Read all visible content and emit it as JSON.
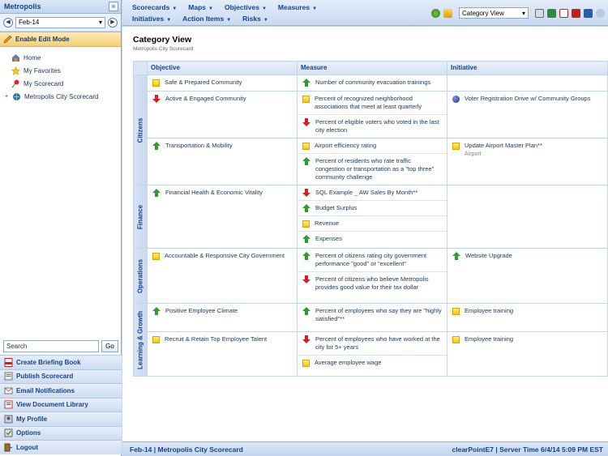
{
  "sidebar": {
    "title": "Metropolis",
    "period": "Feb-14",
    "edit_mode": "Enable Edit Mode",
    "tree": [
      {
        "label": "Home",
        "icon": "home-icon"
      },
      {
        "label": "My Favorites",
        "icon": "star-icon"
      },
      {
        "label": "My Scorecard",
        "icon": "pin-icon"
      },
      {
        "label": "Metropolis City Scorecard",
        "icon": "scorecard-icon"
      }
    ],
    "search_value": "Search",
    "go_label": "Go",
    "actions": [
      {
        "label": "Create Briefing Book",
        "icon": "pdf-icon"
      },
      {
        "label": "Publish Scorecard",
        "icon": "publish-icon"
      },
      {
        "label": "Email Notifications",
        "icon": "email-icon"
      },
      {
        "label": "View Document Library",
        "icon": "library-icon"
      },
      {
        "label": "My Profile",
        "icon": "profile-icon"
      },
      {
        "label": "Options",
        "icon": "options-icon"
      },
      {
        "label": "Logout",
        "icon": "logout-icon"
      }
    ]
  },
  "topbar": {
    "menu_row1": [
      "Scorecards",
      "Maps",
      "Objectives",
      "Measures"
    ],
    "menu_row2": [
      "Initiatives",
      "Action Items",
      "Risks"
    ],
    "view_select": "Category View"
  },
  "main": {
    "title": "Category View",
    "subtitle": "Metropolis City Scorecard",
    "headers": {
      "objective": "Objective",
      "measure": "Measure",
      "initiative": "Initiative"
    },
    "categories": [
      {
        "name": "Citizens"
      },
      {
        "name": "Finance"
      },
      {
        "name": "Operations"
      },
      {
        "name": "Learning & Growth"
      }
    ],
    "rows": {
      "r1": {
        "objective": "Safe & Prepared Community",
        "measures": [
          "Number of community evacuation trainings"
        ]
      },
      "r2": {
        "objective": "Active & Engaged Community",
        "measures": [
          "Percent of recognized neighborhood associations that meet at least quarterly",
          "Percent of eligible voters who voted in the last city election"
        ],
        "initiative": "Voter Registration Drive w/ Community Groups"
      },
      "r3": {
        "objective": "Transportation & Mobility",
        "measures": [
          "Airport efficiency rating",
          "Percent of residents who rate traffic congestion or transportation as a \"top three\" community challenge"
        ],
        "initiative": "Update Airport Master Plan**",
        "initiative_sub": "Airport"
      },
      "r4": {
        "objective": "Financial Health & Economic Vitality",
        "measures": [
          "SQL Example _ AW Sales By Month**",
          "Budget Surplus",
          "Revenue",
          "Expenses"
        ]
      },
      "r5": {
        "objective": "Accountable & Responsive City Government",
        "measures": [
          "Percent of citizens rating city government performance \"good\" or \"excellent\"",
          "Percent of citizens who believe Metropolis provides good value for their tax dollar"
        ],
        "initiative": "Website Upgrade"
      },
      "r6": {
        "objective": "Positive Employee Climate",
        "measures": [
          "Percent of employees who say they are \"highly satisfied\"**"
        ],
        "initiative": "Employee training"
      },
      "r7": {
        "objective": "Recruit & Retain Top Employee Talent",
        "measures": [
          "Percent of employees who have worked at the city for 5+ years",
          "Average employee wage"
        ],
        "initiative": "Employee training"
      }
    }
  },
  "footer": {
    "left": "Feb-14 | Metropolis City Scorecard",
    "right": "clearPointE7 | Server Time 6/4/14 5:09 PM EST"
  },
  "colors": {
    "accent": "#15428b",
    "up": "#2e9d2e",
    "down": "#d42020",
    "neutral": "#f2c418"
  }
}
